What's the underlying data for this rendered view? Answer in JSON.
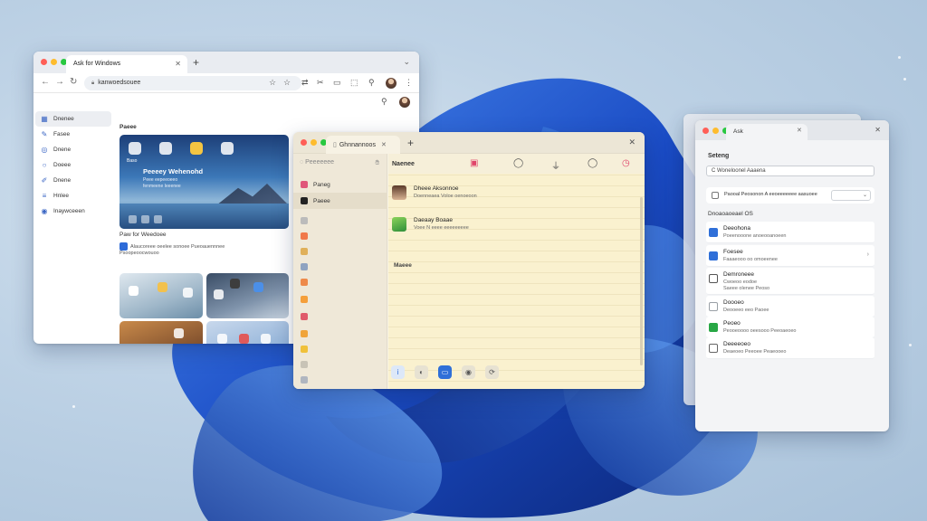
{
  "colors": {
    "accent": "#2f6fd8",
    "desktop_bg": "#b8cde2",
    "bloom_dark": "#0e2f8f",
    "bloom_light": "#3e7ee8",
    "notes_paper": "#faf1cf",
    "traffic_red": "#ff5f57",
    "traffic_yellow": "#febc2e",
    "traffic_green": "#28c840"
  },
  "browser": {
    "tab_title": "Ask for Windows",
    "url": "kanwoedsouee",
    "toolbar_icons": [
      "back-icon",
      "forward-icon",
      "reload-icon",
      "star-icon",
      "bookmark-icon",
      "extension-icon",
      "translate-icon",
      "media-icon",
      "search-icon",
      "avatar",
      "menu-icon"
    ],
    "sidebar": [
      {
        "label": "Dnenee",
        "icon": "home-icon"
      },
      {
        "label": "Fasee",
        "icon": "feather-icon"
      },
      {
        "label": "Dnene",
        "icon": "compass-icon"
      },
      {
        "label": "Doeee",
        "icon": "circle-icon"
      },
      {
        "label": "Dnene",
        "icon": "pen-icon"
      },
      {
        "label": "Hnlee",
        "icon": "list-icon"
      },
      {
        "label": "Inaywceeen",
        "icon": "globe-icon"
      }
    ],
    "main_heading": "Paeee",
    "hero": {
      "title": "Peeeey Wehenohd",
      "subtitle": "Peee eepeeoeeo fenmeene Ieeenee",
      "app_label": "Baso"
    },
    "section_heading": "Paw for Weedoee",
    "section_desc": "Alaucoreee oeelee sonoee Pueoauennnee",
    "section_link": "Psoopeoocwouoo"
  },
  "notes": {
    "tab_title": "Ghnnannoos",
    "sidebar_search": "Peeeeeee",
    "sidebar_rows": [
      {
        "label": "Paneg",
        "color": "#e0567a"
      },
      {
        "label": "Paeee",
        "color": "#222222"
      }
    ],
    "title": "Naenee",
    "entries": [
      {
        "title": "Dheee Aksonnoe",
        "desc": "Doenneaea Voloe oenoeoon"
      },
      {
        "title": "Daeaay Boaae",
        "desc": "Voee N eeee eeeeeeeee"
      }
    ],
    "section": "Maeee",
    "toolbar_icons": [
      "calendar-icon",
      "search-icon",
      "filter-icon",
      "search-icon",
      "clock-icon"
    ],
    "bottom_icons": [
      "info-icon",
      "share-icon",
      "screen-icon",
      "eye-icon",
      "refresh-icon"
    ]
  },
  "settings": {
    "tab_title": "Ask",
    "title": "Seteng",
    "search_value": "C Woneloonel Aaaena",
    "language_row": {
      "title": "Paooal",
      "desc": "Peosonon A eeoeeeeeee aasuoee"
    },
    "group": "Dnoaoaoeael OS",
    "items": [
      {
        "title": "Deeohona",
        "desc": "Poeenooone anoeooanoeen",
        "color": "#2f6fd8"
      },
      {
        "title": "Foesee",
        "desc": "Faaaeooo oo omoeenee",
        "color": "#2f6fd8"
      },
      {
        "title": "Demroneee",
        "desc": "Cwoeoo eodoe\nSaeee olenee Peoso",
        "color": "#555555"
      },
      {
        "title": "Doooeo",
        "desc": "Deooeeo eeo Paoee",
        "color": "#9aa0a6"
      },
      {
        "title": "Peoeo",
        "desc": "Peooeoooo oeesooo Peeoaeoeo",
        "color": "#28a745"
      },
      {
        "title": "Deeeeoeo",
        "desc": "Deaeoeo Peeoee Peaeooeo",
        "color": "#555555"
      }
    ]
  }
}
